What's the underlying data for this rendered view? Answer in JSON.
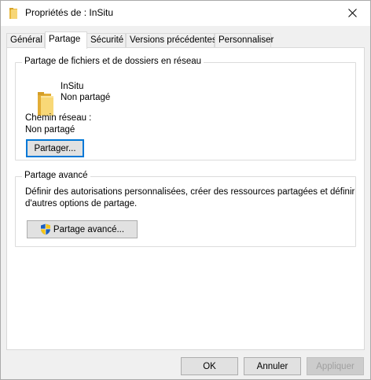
{
  "window": {
    "title": "Propriétés de : InSitu"
  },
  "tabs": [
    {
      "label": "Général"
    },
    {
      "label": "Partage"
    },
    {
      "label": "Sécurité"
    },
    {
      "label": "Versions précédentes"
    },
    {
      "label": "Personnaliser"
    }
  ],
  "network_sharing": {
    "group_title": "Partage de fichiers et de dossiers en réseau",
    "folder_name": "InSitu",
    "folder_status": "Non partagé",
    "path_label": "Chemin réseau :",
    "path_value": "Non partagé",
    "share_button": "Partager..."
  },
  "advanced_sharing": {
    "group_title": "Partage avancé",
    "description_line1": "Définir des autorisations personnalisées, créer des ressources partagées et définir",
    "description_line2": "d'autres options de partage.",
    "button": "Partage avancé..."
  },
  "footer": {
    "ok": "OK",
    "cancel": "Annuler",
    "apply": "Appliquer"
  },
  "icons": {
    "folder": "folder-icon",
    "close": "close-icon",
    "shield": "uac-shield-icon"
  }
}
